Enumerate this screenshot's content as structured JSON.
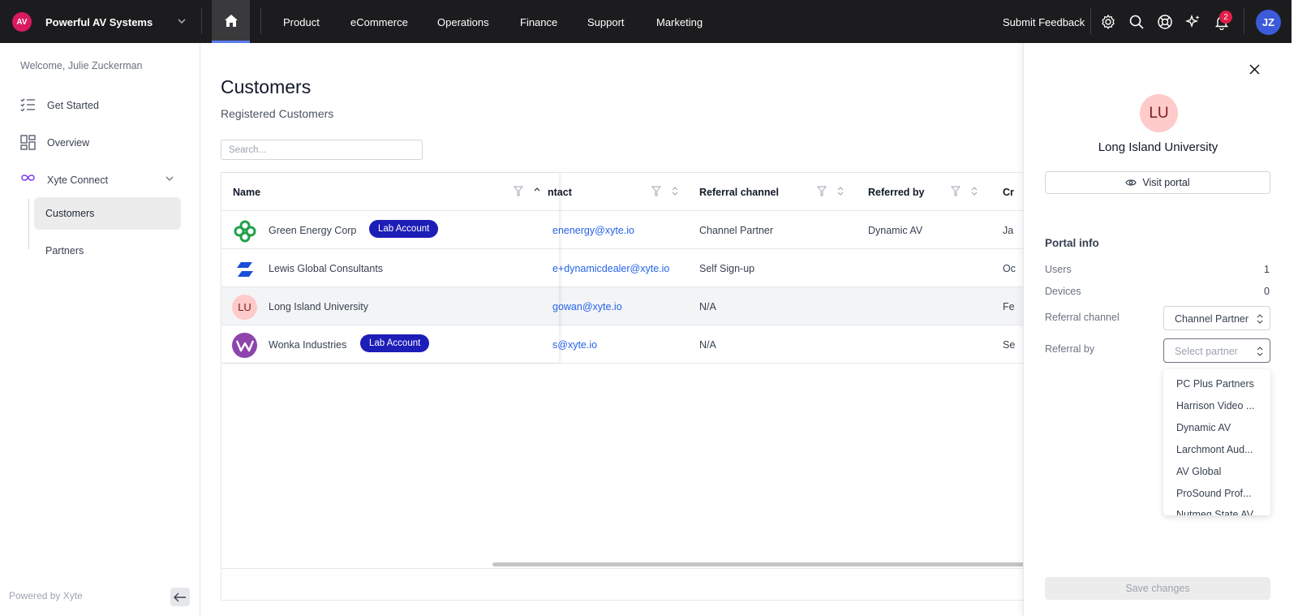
{
  "org": {
    "logo_text": "AV",
    "name": "Powerful AV Systems"
  },
  "nav": {
    "items": [
      "Product",
      "eCommerce",
      "Operations",
      "Finance",
      "Support",
      "Marketing"
    ]
  },
  "header": {
    "feedback": "Submit Feedback",
    "notifications_count": "2",
    "user_initials": "JZ"
  },
  "sidebar": {
    "welcome": "Welcome, Julie Zuckerman",
    "items": [
      {
        "label": "Get Started",
        "icon": "checklist-icon"
      },
      {
        "label": "Overview",
        "icon": "grid-icon"
      },
      {
        "label": "Xyte Connect",
        "icon": "infinity-icon"
      }
    ],
    "subitems": [
      "Customers",
      "Partners"
    ],
    "powered": "Powered by Xyte"
  },
  "page": {
    "title": "Customers",
    "subtitle": "Registered Customers",
    "search_placeholder": "Search..."
  },
  "table": {
    "columns": [
      "Name",
      "ntact",
      "Referral channel",
      "Referred by",
      "Cr"
    ],
    "rows": [
      {
        "name": "Green Energy Corp",
        "badge": "Lab Account",
        "contact": "enenergy@xyte.io",
        "channel": "Channel Partner",
        "referred_by": "Dynamic AV",
        "created": "Ja"
      },
      {
        "name": "Lewis Global Consultants",
        "badge": "",
        "contact": "e+dynamicdealer@xyte.io",
        "channel": "Self Sign-up",
        "referred_by": "",
        "created": "Oc"
      },
      {
        "name": "Long Island University",
        "initials": "LU",
        "badge": "",
        "contact": "gowan@xyte.io",
        "channel": "N/A",
        "referred_by": "",
        "created": "Fe"
      },
      {
        "name": "Wonka Industries",
        "badge": "Lab Account",
        "contact": "s@xyte.io",
        "channel": "N/A",
        "referred_by": "",
        "created": "Se"
      }
    ]
  },
  "panel": {
    "initials": "LU",
    "name": "Long Island University",
    "visit": "Visit portal",
    "info_title": "Portal info",
    "users_label": "Users",
    "users_value": "1",
    "devices_label": "Devices",
    "devices_value": "0",
    "channel_label": "Referral channel",
    "channel_value": "Channel Partner",
    "referral_label": "Referral by",
    "referral_placeholder": "Select partner",
    "options": [
      "PC Plus Partners",
      "Harrison Video ...",
      "Dynamic AV",
      "Larchmont Aud...",
      "AV Global",
      "ProSound Prof...",
      "Nutmeg State AV"
    ],
    "save": "Save changes"
  },
  "colors": {
    "accent": "#5b7cfa",
    "brand": "#d81b60",
    "lab_badge": "#1d1db8",
    "link": "#2563eb"
  }
}
